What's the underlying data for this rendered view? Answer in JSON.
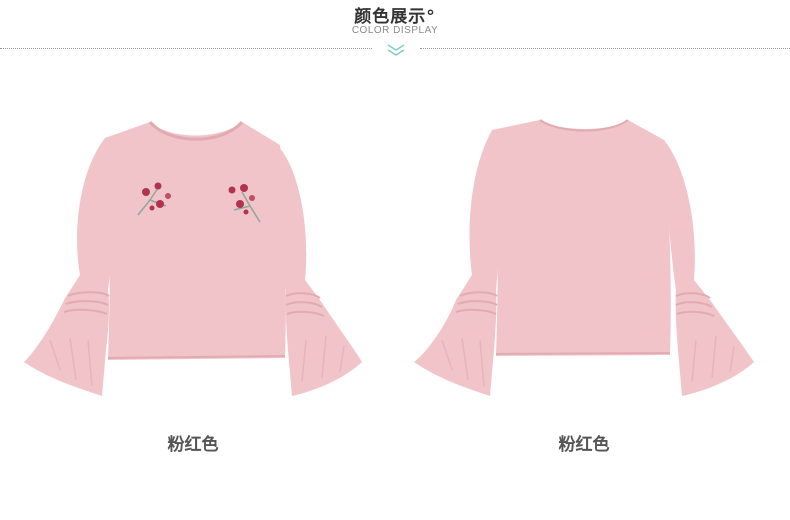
{
  "header": {
    "title": "颜色展示°",
    "subtitle": "COLOR DISPLAY"
  },
  "products": [
    {
      "caption": "粉红色",
      "view": "front",
      "image": "pink-flare-sleeve-top-front"
    },
    {
      "caption": "粉红色",
      "view": "back",
      "image": "pink-flare-sleeve-top-back"
    }
  ],
  "colors": {
    "title": "#333333",
    "subtitle": "#8a8a8a",
    "divider": "#9a9a9a",
    "chevron": "#7fcfc9",
    "garment": "#f0c4c9",
    "garment_shadow": "#e2aab1",
    "embroidery_flower": "#b0344d",
    "embroidery_leaf": "#8fa89a",
    "caption": "#555555"
  }
}
